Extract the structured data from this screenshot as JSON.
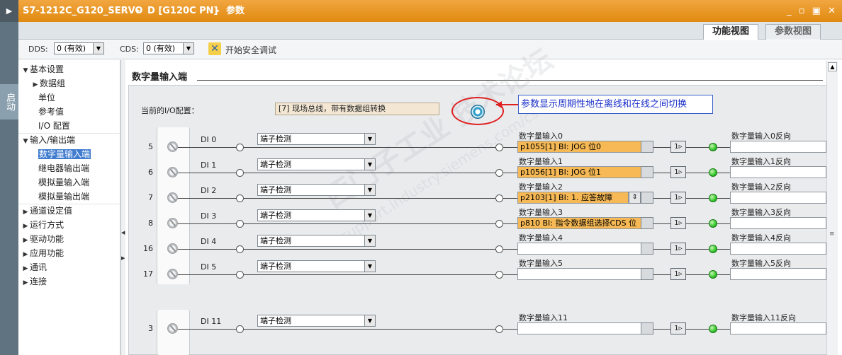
{
  "titlebar": {
    "crumb1": "S7-1212C_G120_SERVO",
    "sep1": "▸",
    "crumb2": "D [G120C PN]",
    "sep2": "▸",
    "crumb3": "参数",
    "window_buttons": "_ ▫ ▣ ✕"
  },
  "left_strip": {
    "label": "启动"
  },
  "view_tabs": {
    "function_view": "功能视图",
    "param_view": "参数视图"
  },
  "toolbar": {
    "dds_label": "DDS:",
    "dds_value": "0 (有效)",
    "cds_label": "CDS:",
    "cds_value": "0 (有效)",
    "safety_label": "开始安全调试"
  },
  "sidebar": {
    "items": [
      {
        "label": "基本设置",
        "arrow": "▼"
      },
      {
        "label": "数据组",
        "arrow": "▶"
      },
      {
        "label": "单位",
        "arrow": ""
      },
      {
        "label": "参考值",
        "arrow": ""
      },
      {
        "label": "I/O 配置",
        "arrow": ""
      },
      {
        "label": "输入/输出端",
        "arrow": "▼"
      },
      {
        "label": "数字量输入端",
        "arrow": ""
      },
      {
        "label": "继电器输出端",
        "arrow": ""
      },
      {
        "label": "模拟量输入端",
        "arrow": ""
      },
      {
        "label": "模拟量输出端",
        "arrow": ""
      },
      {
        "label": "通道设定值",
        "arrow": "▶"
      },
      {
        "label": "运行方式",
        "arrow": "▶"
      },
      {
        "label": "驱动功能",
        "arrow": "▶"
      },
      {
        "label": "应用功能",
        "arrow": "▶"
      },
      {
        "label": "通讯",
        "arrow": "▶"
      },
      {
        "label": "连接",
        "arrow": "▶"
      }
    ]
  },
  "section": {
    "title": "数字量输入端",
    "io_config_label": "当前的I/O配置：",
    "io_config_value": "[7] 现场总线，带有数据组转换",
    "annotation": "参数显示周期性地在离线和在线之间切换"
  },
  "rows": [
    {
      "num": "5",
      "di": "DI 0",
      "func": "端子检测",
      "sig_label": "数字量输入0",
      "sig_value": "p1055[1] BI: JOG 位0",
      "out_label": "数字量输入0反向"
    },
    {
      "num": "6",
      "di": "DI 1",
      "func": "端子检测",
      "sig_label": "数字量输入1",
      "sig_value": "p1056[1] BI: JOG 位1",
      "out_label": "数字量输入1反向"
    },
    {
      "num": "7",
      "di": "DI 2",
      "func": "端子检测",
      "sig_label": "数字量输入2",
      "sig_value": "p2103[1] BI: 1. 应答故障",
      "out_label": "数字量输入2反向"
    },
    {
      "num": "8",
      "di": "DI 3",
      "func": "端子检测",
      "sig_label": "数字量输入3",
      "sig_value": "p810 BI: 指令数据组选择CDS 位",
      "out_label": "数字量输入3反向"
    },
    {
      "num": "16",
      "di": "DI 4",
      "func": "端子检测",
      "sig_label": "数字量输入4",
      "sig_value": "",
      "out_label": "数字量输入4反向"
    },
    {
      "num": "17",
      "di": "DI 5",
      "func": "端子检测",
      "sig_label": "数字量输入5",
      "sig_value": "",
      "out_label": "数字量输入5反向"
    },
    {
      "num": "3",
      "di": "DI 11",
      "func": "端子检测",
      "sig_label": "数字量输入11",
      "sig_value": "",
      "out_label": "数字量输入11反向"
    }
  ],
  "inv_symbol": "1",
  "watermark": {
    "line1": "西门子工业 技术论坛",
    "line2": "support.industry.siemens.com/cs"
  }
}
